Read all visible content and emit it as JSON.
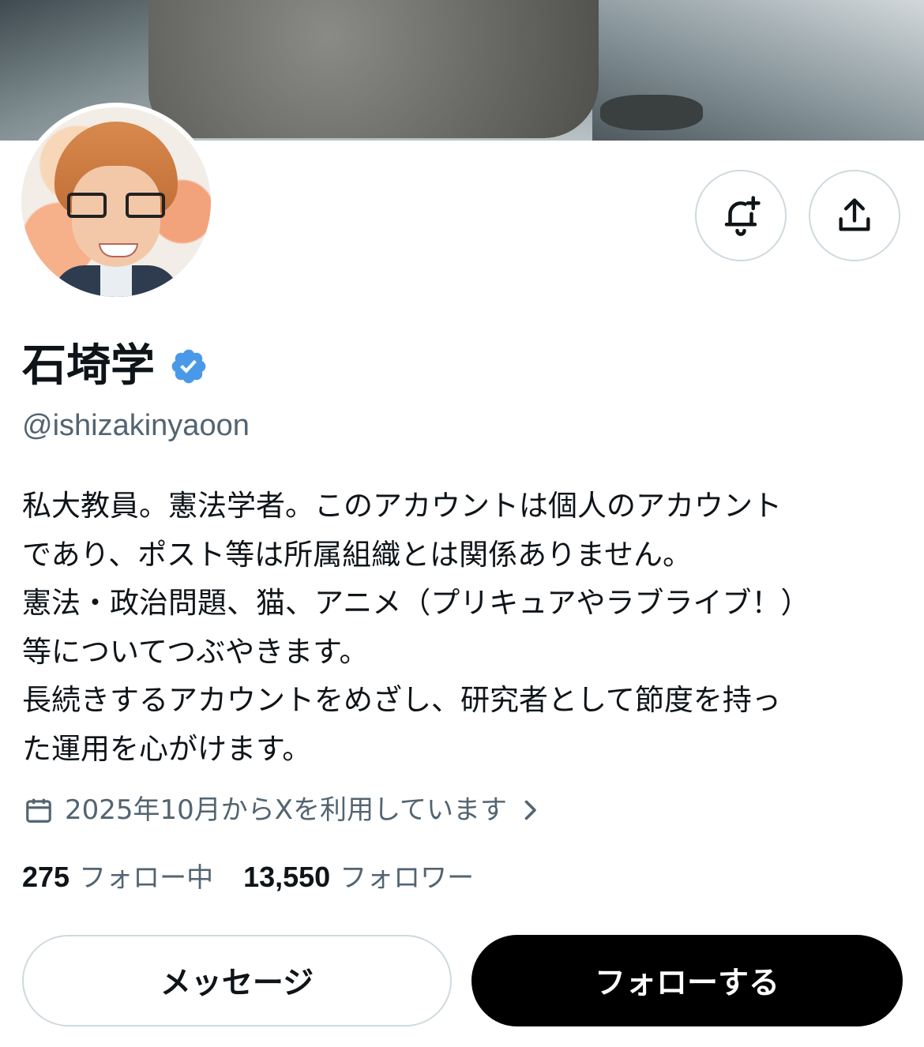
{
  "profile": {
    "display_name": "石埼学",
    "handle": "@ishizakinyaoon",
    "bio": "私大教員。憲法学者。このアカウントは個人のアカウント\nであり、ポスト等は所属組織とは関係ありません。\n憲法・政治問題、猫、アニメ（プリキュアやラブライブ！）\n等についてつぶやきます。\n長続きするアカウントをめざし、研究者として節度を持っ\nた運用を心がけます。",
    "joined": "2025年10月からXを利用しています",
    "following_count": "275",
    "following_label": "フォロー中",
    "followers_count": "13,550",
    "followers_label": "フォロワー"
  },
  "actions": {
    "notify_icon": "bell-plus-icon",
    "share_icon": "share-icon",
    "message_label": "メッセージ",
    "follow_label": "フォローする"
  },
  "colors": {
    "verified": "#4a99e9",
    "secondary_text": "#536471",
    "border": "#cfd9de"
  }
}
